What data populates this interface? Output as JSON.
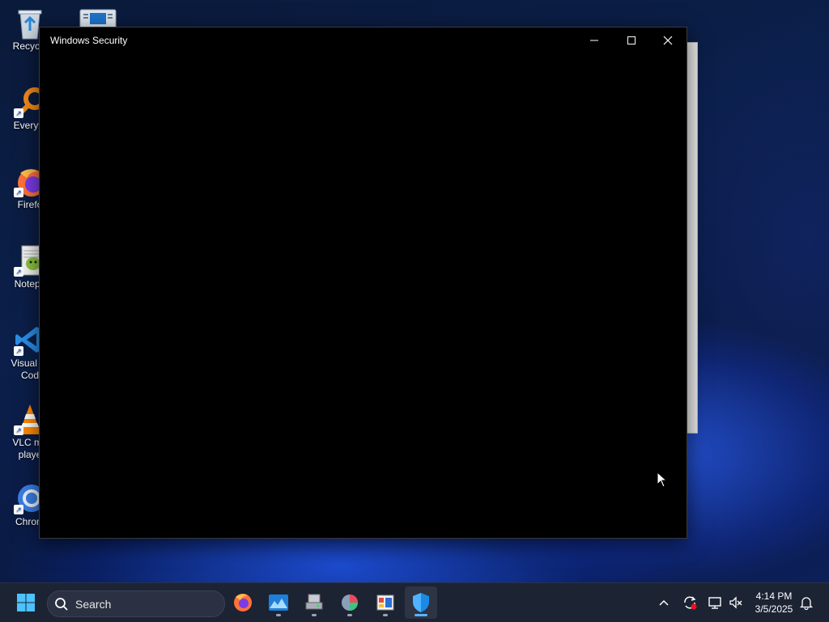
{
  "window": {
    "title": "Windows Security"
  },
  "desktop_icons": [
    {
      "name": "recycle-bin",
      "label": "Recycle"
    },
    {
      "name": "control-panel",
      "label": ""
    },
    {
      "name": "everything",
      "label": "Everyth"
    },
    {
      "name": "firefox",
      "label": "Firefo"
    },
    {
      "name": "notepad",
      "label": "Notepa"
    },
    {
      "name": "vscode",
      "label": "Visual St\nCod"
    },
    {
      "name": "vlc",
      "label": "VLC me\nplaye"
    },
    {
      "name": "chrome",
      "label": "Chrom"
    }
  ],
  "taskbar": {
    "search_placeholder": "Search",
    "apps": [
      "firefox-icon",
      "photos-icon",
      "network-drive-icon",
      "color-app-icon",
      "file-explorer-icon",
      "windows-security-icon"
    ],
    "active_app": "windows-security-icon"
  },
  "tray": {
    "time": "4:14 PM",
    "date": "3/5/2025"
  },
  "colors": {
    "accent": "#0078d4",
    "taskbar": "#1c2333",
    "window_bg": "#000000"
  }
}
